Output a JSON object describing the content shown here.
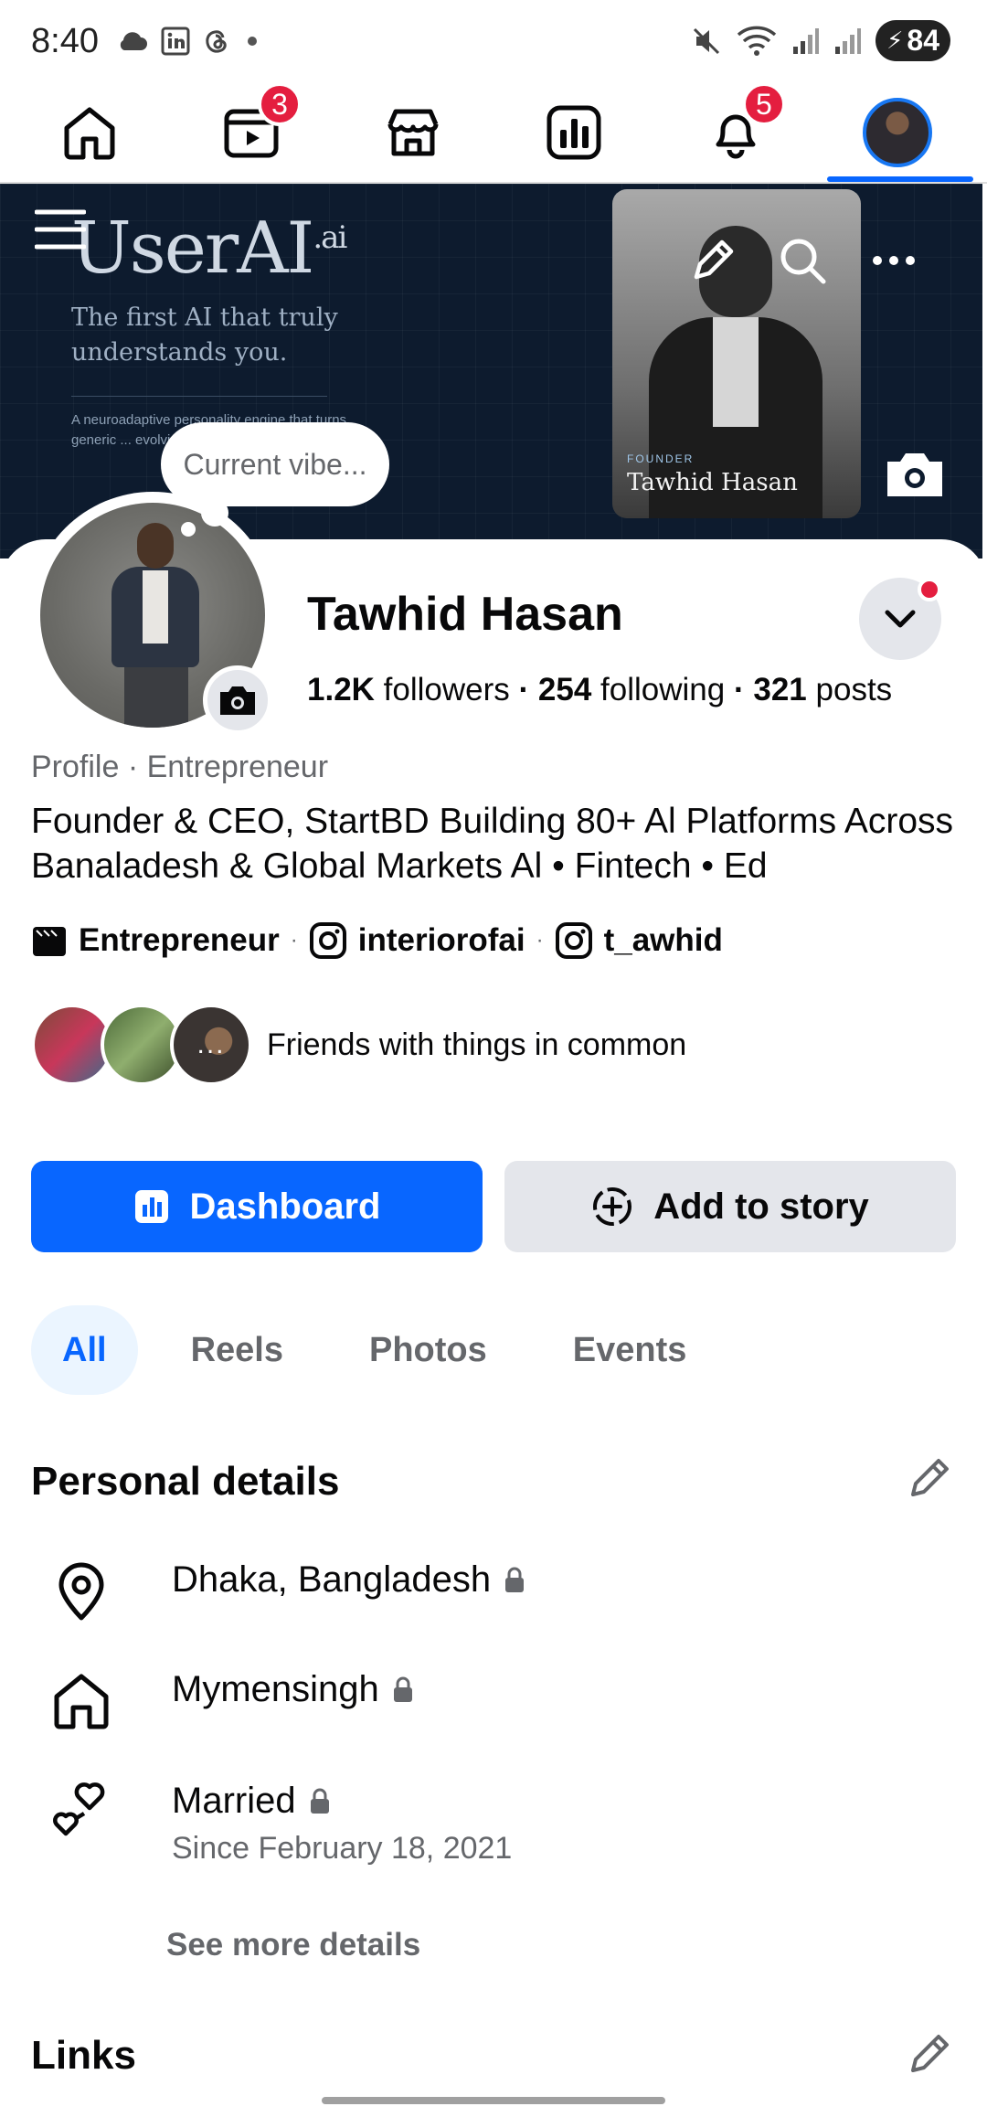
{
  "status_bar": {
    "time": "8:40",
    "battery": "84",
    "icons": [
      "cloud-icon",
      "linkedin-icon",
      "threads-icon",
      "dot-icon",
      "mute-icon",
      "wifi-icon",
      "signal-icon",
      "signal-icon",
      "battery-icon"
    ]
  },
  "top_nav": {
    "items": [
      {
        "name": "home",
        "icon": "home-icon",
        "badge": ""
      },
      {
        "name": "video",
        "icon": "video-icon",
        "badge": "3"
      },
      {
        "name": "marketplace",
        "icon": "marketplace-icon",
        "badge": ""
      },
      {
        "name": "dashboard",
        "icon": "dashboard-icon",
        "badge": ""
      },
      {
        "name": "notifications",
        "icon": "bell-icon",
        "badge": "5"
      },
      {
        "name": "profile",
        "icon": "profile-avatar",
        "badge": ""
      }
    ],
    "active": "profile"
  },
  "cover": {
    "brand": "UserAI",
    "brand_sup": ".ai",
    "tagline": "The first AI that truly understands you.",
    "small_text": "A neuroadaptive personality engine that turns generic ... evolving exte...",
    "founder_label": "FOUNDER",
    "founder_name": "Tawhid Hasan"
  },
  "vibe_bubble": "Current vibe...",
  "profile": {
    "name": "Tawhid Hasan",
    "followers_count": "1.2K",
    "followers_label": "followers",
    "following_count": "254",
    "following_label": "following",
    "posts_count": "321",
    "posts_label": "posts",
    "subtitle": "Profile · Entrepreneur",
    "bio": "Founder & CEO, StartBD Building 80+ Al Platforms Across Banaladesh & Global Markets Al • Fintech • Ed"
  },
  "links": [
    {
      "icon": "category-icon",
      "label": "Entrepreneur"
    },
    {
      "icon": "instagram-icon",
      "label": "interiorofai"
    },
    {
      "icon": "instagram-icon",
      "label": "t_awhid"
    }
  ],
  "friends": {
    "text": "Friends with things in common",
    "more": "..."
  },
  "buttons": {
    "primary": "Dashboard",
    "secondary": "Add to story"
  },
  "tabs": [
    {
      "label": "All",
      "active": true
    },
    {
      "label": "Reels",
      "active": false
    },
    {
      "label": "Photos",
      "active": false
    },
    {
      "label": "Events",
      "active": false
    }
  ],
  "personal_details": {
    "title": "Personal details",
    "items": [
      {
        "icon": "location-icon",
        "label": "Dhaka, Bangladesh",
        "sub": ""
      },
      {
        "icon": "home-icon",
        "label": "Mymensingh",
        "sub": ""
      },
      {
        "icon": "hearts-icon",
        "label": "Married",
        "sub": "Since February 18, 2021"
      }
    ],
    "see_more": "See more details"
  },
  "links_section": {
    "title": "Links"
  },
  "colors": {
    "accent": "#0866ff",
    "badge": "#e41e3f",
    "secondary_button": "#e4e6eb",
    "muted_text": "#65676b",
    "cover_bg": "#0d1b2e"
  }
}
